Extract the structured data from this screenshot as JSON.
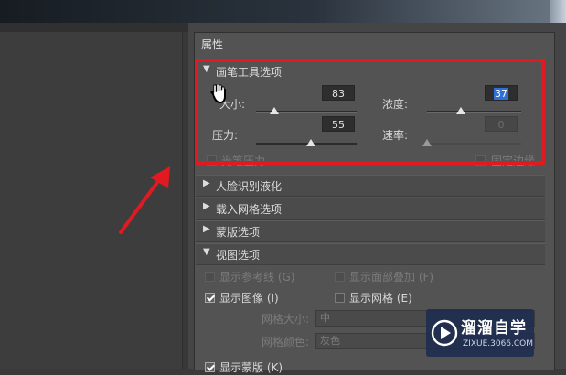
{
  "panel": {
    "title": "属性"
  },
  "brush_section": {
    "label": "画笔工具选项",
    "size_label": "大小:",
    "size_value": "83",
    "pressure_label": "压力:",
    "pressure_value": "55",
    "density_label": "浓度:",
    "density_value": "37",
    "rate_label": "速率:",
    "rate_value": "0",
    "stylus_label": "光笔压力",
    "pin_edges_label": "固定边缘"
  },
  "sections": {
    "face_aware": "人脸识别液化",
    "load_mesh": "载入网格选项",
    "mask": "蒙版选项",
    "view": "视图选项"
  },
  "view_options": {
    "show_guides": "显示参考线 (G)",
    "show_face_overlay": "显示面部叠加 (F)",
    "show_image": "显示图像 (I)",
    "show_mesh": "显示网格 (E)",
    "mesh_size_label": "网格大小:",
    "mesh_size_value": "中",
    "mesh_color_label": "网格颜色:",
    "mesh_color_value": "灰色",
    "show_mask": "显示蒙版 (K)"
  },
  "watermark": {
    "title": "溜溜自学",
    "url": "ZIXUE.3066.COM"
  },
  "colors": {
    "highlight": "#e11a21",
    "selection": "#2f6fd6"
  },
  "icons": {
    "expanded": "triangle-down-icon",
    "collapsed": "triangle-right-icon",
    "pointer": "hand-cursor-icon"
  }
}
